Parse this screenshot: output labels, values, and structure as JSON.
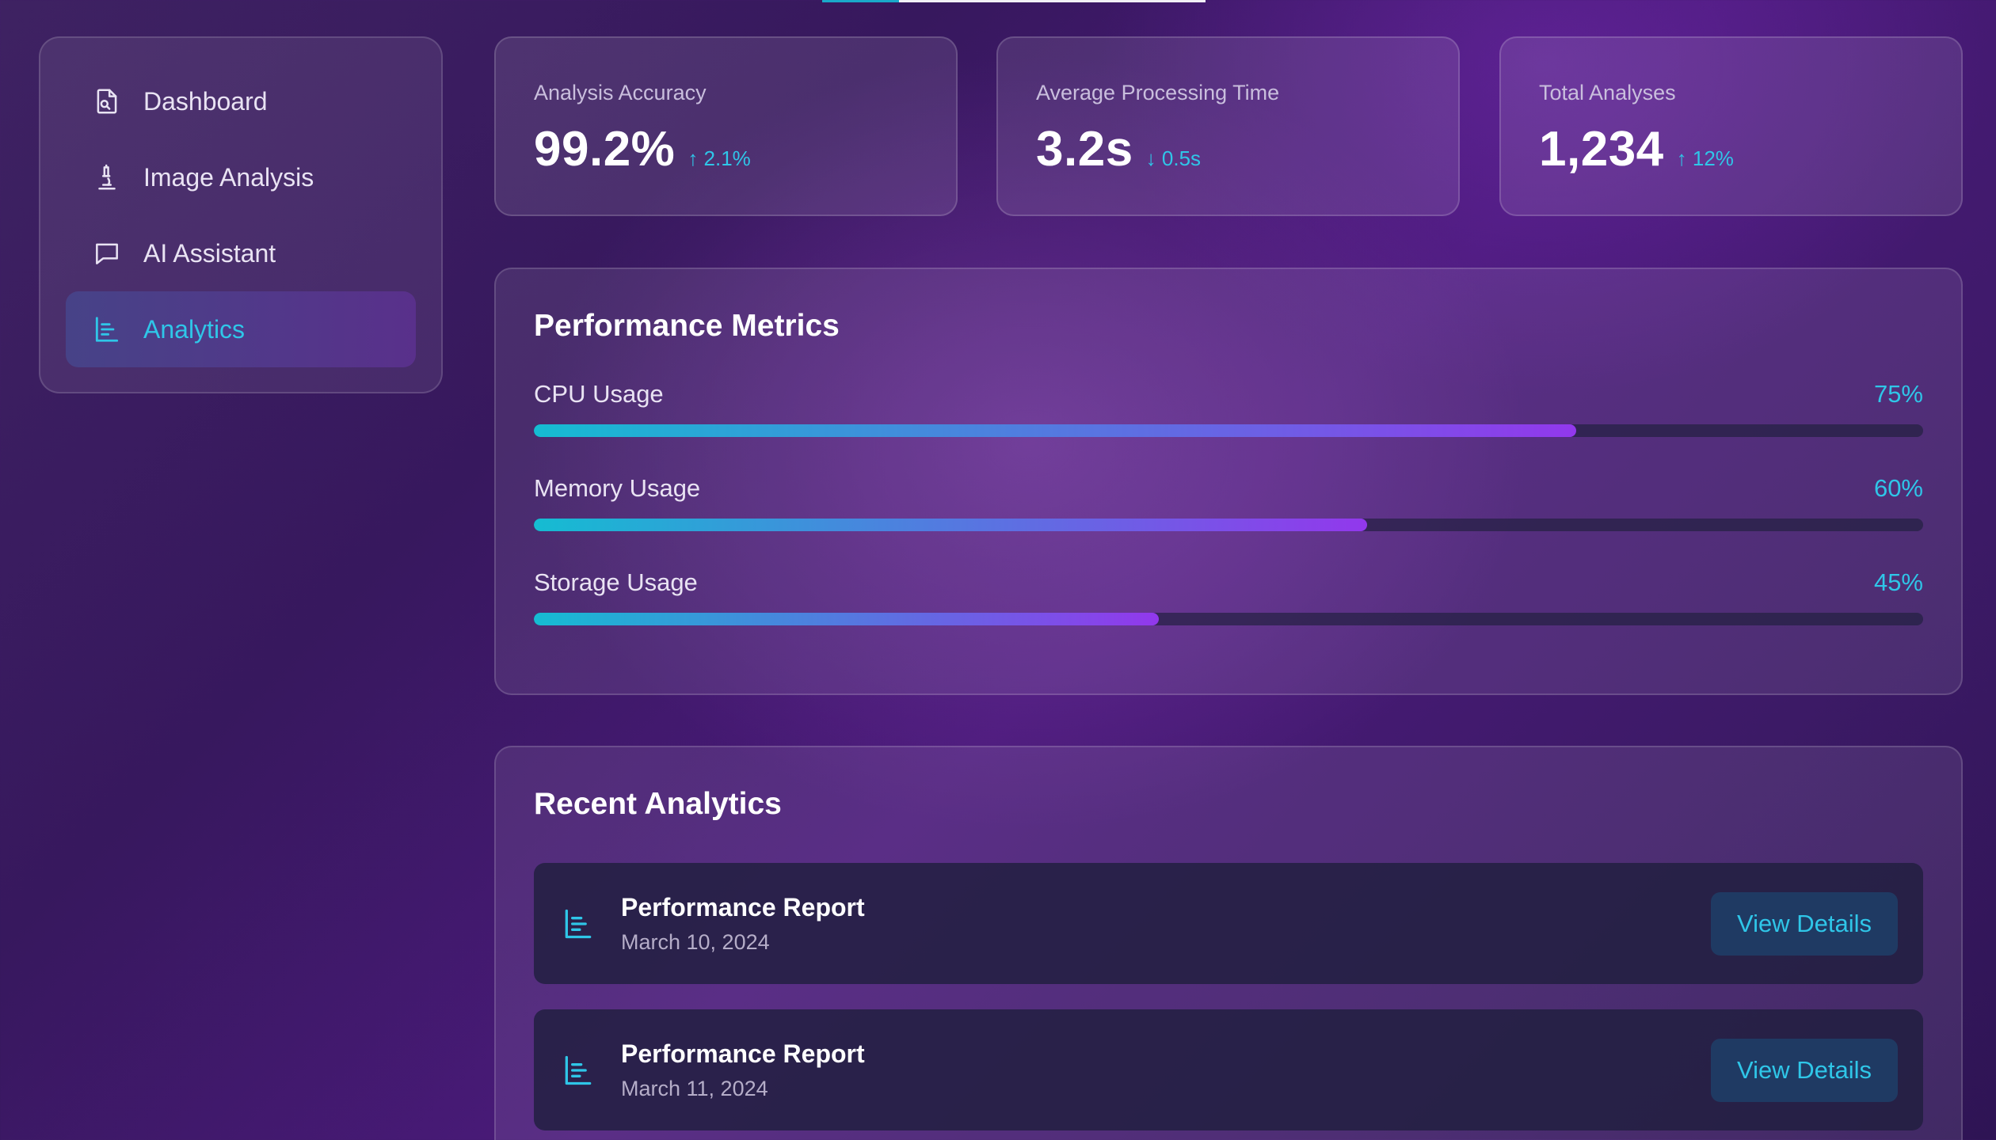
{
  "sidebar": {
    "items": [
      {
        "label": "Dashboard",
        "icon": "document-search-icon",
        "active": false
      },
      {
        "label": "Image Analysis",
        "icon": "microscope-icon",
        "active": false
      },
      {
        "label": "AI Assistant",
        "icon": "chat-bubble-icon",
        "active": false
      },
      {
        "label": "Analytics",
        "icon": "bar-chart-icon",
        "active": true
      }
    ]
  },
  "stats": [
    {
      "label": "Analysis Accuracy",
      "value": "99.2%",
      "change": "↑ 2.1%"
    },
    {
      "label": "Average Processing Time",
      "value": "3.2s",
      "change": "↓ 0.5s"
    },
    {
      "label": "Total Analyses",
      "value": "1,234",
      "change": "↑ 12%"
    }
  ],
  "performance": {
    "title": "Performance Metrics",
    "metrics": [
      {
        "label": "CPU Usage",
        "percent_text": "75%",
        "value": 75
      },
      {
        "label": "Memory Usage",
        "percent_text": "60%",
        "value": 60
      },
      {
        "label": "Storage Usage",
        "percent_text": "45%",
        "value": 45
      }
    ]
  },
  "recent": {
    "title": "Recent Analytics",
    "items": [
      {
        "title": "Performance Report",
        "date": "March 10, 2024",
        "button": "View Details",
        "icon": "bar-chart-icon"
      },
      {
        "title": "Performance Report",
        "date": "March 11, 2024",
        "button": "View Details",
        "icon": "bar-chart-icon"
      }
    ]
  },
  "colors": {
    "accent": "#2fc6e8",
    "bar_gradient_start": "#15bcd2",
    "bar_gradient_end": "#9238ec",
    "button_bg": "#1f3a63"
  },
  "top_progress": {
    "value": 0.2
  }
}
